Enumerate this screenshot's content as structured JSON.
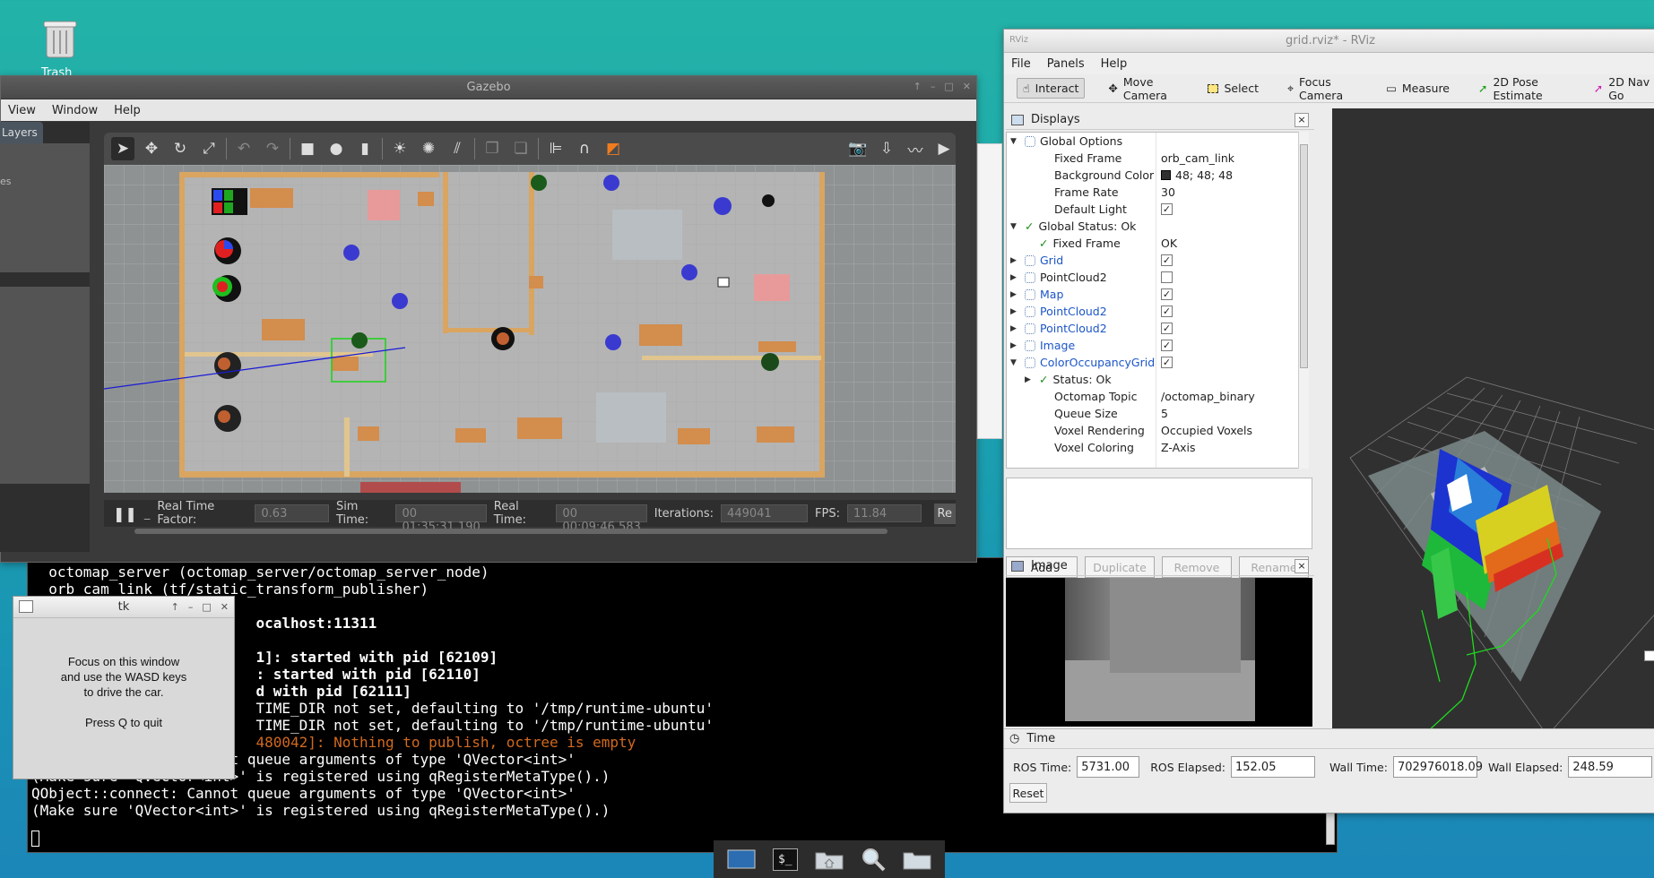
{
  "desktop": {
    "trash_label": "Trash"
  },
  "gazebo": {
    "title": "Gazebo",
    "menu": [
      "View",
      "Window",
      "Help"
    ],
    "left_tab": "Layers",
    "left_text": "es",
    "status": {
      "rtf_label": "Real Time Factor:",
      "rtf_value": "0.63",
      "sim_label": "Sim Time:",
      "sim_value": "00 01:35:31.190",
      "real_label": "Real Time:",
      "real_value": "00 00:09:46.583",
      "iter_label": "Iterations:",
      "iter_value": "449041",
      "fps_label": "FPS:",
      "fps_value": "11.84",
      "reset_label": "Re"
    }
  },
  "terminal": {
    "lines": [
      {
        "t": "  octomap_server (octomap_server/octomap_server_node)",
        "c": ""
      },
      {
        "t": "  orb_cam_link (tf/static_transform_publisher)",
        "c": ""
      },
      {
        "t": "",
        "c": ""
      },
      {
        "t": "                          ocalhost:11311",
        "c": "bold"
      },
      {
        "t": "",
        "c": ""
      },
      {
        "t": "                          1]: started with pid [62109]",
        "c": "bold"
      },
      {
        "t": "                          : started with pid [62110]",
        "c": "bold"
      },
      {
        "t": "                          d with pid [62111]",
        "c": "bold"
      },
      {
        "t": "                          TIME_DIR not set, defaulting to '/tmp/runtime-ubuntu'",
        "c": ""
      },
      {
        "t": "                          TIME_DIR not set, defaulting to '/tmp/runtime-ubuntu'",
        "c": ""
      },
      {
        "t": "                          480042]: Nothing to publish, octree is empty",
        "c": "orange"
      },
      {
        "t": "QObject::connect: Cannot queue arguments of type 'QVector<int>'",
        "c": ""
      },
      {
        "t": "(Make sure 'QVector<int>' is registered using qRegisterMetaType().)",
        "c": ""
      },
      {
        "t": "QObject::connect: Cannot queue arguments of type 'QVector<int>'",
        "c": ""
      },
      {
        "t": "(Make sure 'QVector<int>' is registered using qRegisterMetaType().)",
        "c": ""
      }
    ]
  },
  "tk": {
    "title": "tk",
    "line1": "Focus on this window",
    "line2": "and use the WASD keys",
    "line3": "to drive the car.",
    "line4": "Press Q to quit"
  },
  "rviz": {
    "title": "grid.rviz* - RViz",
    "menu": [
      "File",
      "Panels",
      "Help"
    ],
    "tools": [
      "Interact",
      "Move Camera",
      "Select",
      "Focus Camera",
      "Measure",
      "2D Pose Estimate",
      "2D Nav Go"
    ],
    "displays_title": "Displays",
    "rows": [
      {
        "name": "Global Options",
        "value": "",
        "indent": 0,
        "exp": "▼",
        "cls": "",
        "check": false,
        "cb": null
      },
      {
        "name": "Fixed Frame",
        "value": "orb_cam_link",
        "indent": 1,
        "exp": "",
        "cls": "",
        "check": false,
        "cb": null
      },
      {
        "name": "Background Color",
        "value": "48; 48; 48",
        "indent": 1,
        "exp": "",
        "cls": "",
        "check": false,
        "cb": null,
        "swatch": "#303030"
      },
      {
        "name": "Frame Rate",
        "value": "30",
        "indent": 1,
        "exp": "",
        "cls": "",
        "check": false,
        "cb": null
      },
      {
        "name": "Default Light",
        "value": "",
        "indent": 1,
        "exp": "",
        "cls": "",
        "check": false,
        "cb": true
      },
      {
        "name": "Global Status: Ok",
        "value": "",
        "indent": 0,
        "exp": "▼",
        "cls": "",
        "check": true,
        "cb": null
      },
      {
        "name": "Fixed Frame",
        "value": "OK",
        "indent": 1,
        "exp": "",
        "cls": "",
        "check": true,
        "cb": null
      },
      {
        "name": "Grid",
        "value": "",
        "indent": 0,
        "exp": "▶",
        "cls": "blue",
        "check": false,
        "cb": true
      },
      {
        "name": "PointCloud2",
        "value": "",
        "indent": 0,
        "exp": "▶",
        "cls": "",
        "check": false,
        "cb": false
      },
      {
        "name": "Map",
        "value": "",
        "indent": 0,
        "exp": "▶",
        "cls": "blue",
        "check": false,
        "cb": true
      },
      {
        "name": "PointCloud2",
        "value": "",
        "indent": 0,
        "exp": "▶",
        "cls": "blue",
        "check": false,
        "cb": true
      },
      {
        "name": "PointCloud2",
        "value": "",
        "indent": 0,
        "exp": "▶",
        "cls": "blue",
        "check": false,
        "cb": true
      },
      {
        "name": "Image",
        "value": "",
        "indent": 0,
        "exp": "▶",
        "cls": "blue",
        "check": false,
        "cb": true
      },
      {
        "name": "ColorOccupancyGrid",
        "value": "",
        "indent": 0,
        "exp": "▼",
        "cls": "blue",
        "check": false,
        "cb": true
      },
      {
        "name": "Status: Ok",
        "value": "",
        "indent": 1,
        "exp": "▶",
        "cls": "",
        "check": true,
        "cb": null
      },
      {
        "name": "Octomap Topic",
        "value": "/octomap_binary",
        "indent": 1,
        "exp": "",
        "cls": "",
        "check": false,
        "cb": null
      },
      {
        "name": "Queue Size",
        "value": "5",
        "indent": 1,
        "exp": "",
        "cls": "",
        "check": false,
        "cb": null
      },
      {
        "name": "Voxel Rendering",
        "value": "Occupied Voxels",
        "indent": 1,
        "exp": "",
        "cls": "",
        "check": false,
        "cb": null
      },
      {
        "name": "Voxel Coloring",
        "value": "Z-Axis",
        "indent": 1,
        "exp": "",
        "cls": "",
        "check": false,
        "cb": null
      }
    ],
    "buttons": {
      "add": "Add",
      "duplicate": "Duplicate",
      "remove": "Remove",
      "rename": "Rename"
    },
    "image_title": "Image",
    "time": {
      "title": "Time",
      "ros_time_label": "ROS Time:",
      "ros_time": "5731.00",
      "ros_elapsed_label": "ROS Elapsed:",
      "ros_elapsed": "152.05",
      "wall_time_label": "Wall Time:",
      "wall_time": "702976018.09",
      "wall_elapsed_label": "Wall Elapsed:",
      "wall_elapsed": "248.59",
      "reset": "Reset"
    }
  },
  "taskbar": {
    "terminal_glyph": "$_"
  },
  "colors": {
    "rviz_viewport": "#303030",
    "terminal_bg": "#000000",
    "gazebo_dark": "#3a3a3a"
  }
}
